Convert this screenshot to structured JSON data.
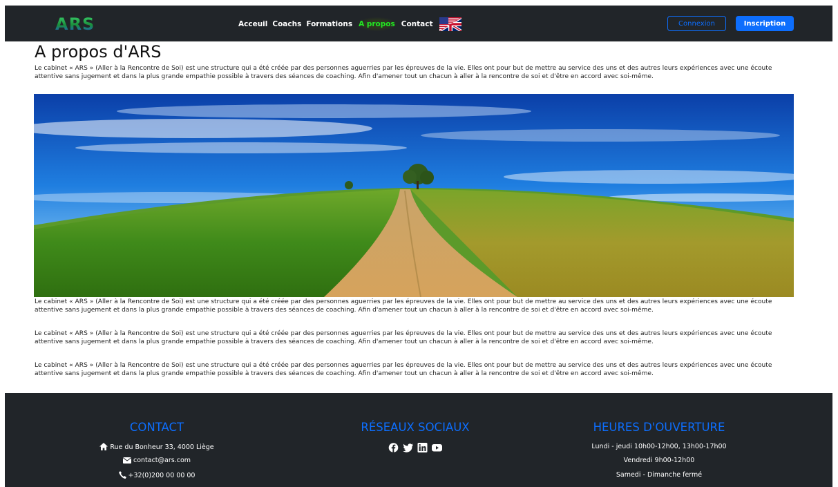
{
  "navbar": {
    "logo": "ARS",
    "links": [
      "Acceuil",
      "Coachs",
      "Formations",
      "A propos",
      "Contact"
    ],
    "active_link": "A propos",
    "language_icon": "uk-us-flag-icon",
    "login_label": "Connexion",
    "signup_label": "Inscription"
  },
  "main": {
    "title": "A propos d'ARS",
    "intro": "Le cabinet « ARS » (Aller à la Rencontre de Soi) est une structure qui a été créée par des personnes aguerries par les épreuves de la vie. Elles ont pour but de mettre au service des uns et des autres leurs expériences avec une écoute attentive sans jugement et dans la plus grande empathie possible à travers des séances de coaching. Afin d'amener tout un chacun à aller à la rencontre de soi et d'être en accord avec soi-même.",
    "paragraphs": [
      "Le cabinet « ARS » (Aller à la Rencontre de Soi) est une structure qui a été créée par des personnes aguerries par les épreuves de la vie. Elles ont pour but de mettre au service des uns et des autres leurs expériences avec une écoute attentive sans jugement et dans la plus grande empathie possible à travers des séances de coaching. Afin d'amener tout un chacun à aller à la rencontre de soi et d'être en accord avec soi-même.",
      "Le cabinet « ARS » (Aller à la Rencontre de Soi) est une structure qui a été créée par des personnes aguerries par les épreuves de la vie. Elles ont pour but de mettre au service des uns et des autres leurs expériences avec une écoute attentive sans jugement et dans la plus grande empathie possible à travers des séances de coaching. Afin d'amener tout un chacun à aller à la rencontre de soi et d'être en accord avec soi-même.",
      "Le cabinet « ARS » (Aller à la Rencontre de Soi) est une structure qui a été créée par des personnes aguerries par les épreuves de la vie. Elles ont pour but de mettre au service des uns et des autres leurs expériences avec une écoute attentive sans jugement et dans la plus grande empathie possible à travers des séances de coaching. Afin d'amener tout un chacun à aller à la rencontre de soi et d'être en accord avec soi-même."
    ]
  },
  "footer": {
    "contact": {
      "heading": "CONTACT",
      "address": "Rue du Bonheur 33, 4000 Liège",
      "email": "contact@ars.com",
      "phone": "+32(0)200 00 00 00"
    },
    "social": {
      "heading": "RÉSEAUX SOCIAUX",
      "icons": [
        "facebook-icon",
        "twitter-icon",
        "linkedin-icon",
        "youtube-icon"
      ]
    },
    "hours": {
      "heading": "HEURES D'OUVERTURE",
      "lines": [
        "Lundi - jeudi 10h00-12h00, 13h00-17h00",
        "Vendredi 9h00-12h00",
        "Samedi - Dimanche fermé"
      ]
    }
  },
  "colors": {
    "navbar_bg": "#212529",
    "accent_blue": "#0d6efd",
    "active_green": "#22e522"
  }
}
